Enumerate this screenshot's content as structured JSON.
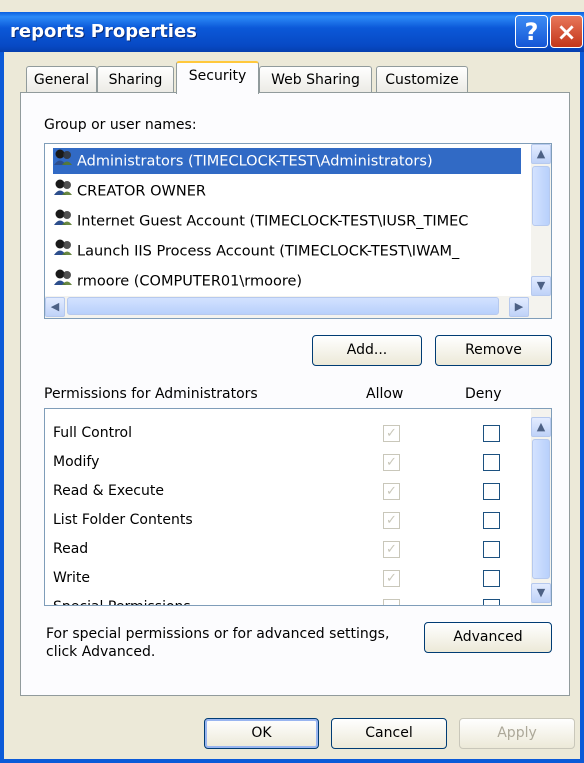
{
  "window": {
    "title": "reports Properties",
    "help_glyph": "?",
    "close_glyph": "×"
  },
  "tabs": [
    {
      "label": "General"
    },
    {
      "label": "Sharing"
    },
    {
      "label": "Security"
    },
    {
      "label": "Web Sharing"
    },
    {
      "label": "Customize"
    }
  ],
  "security": {
    "group_label": "Group or user names:",
    "users": [
      {
        "name": "Administrators (TIMECLOCK-TEST\\Administrators)",
        "selected": true
      },
      {
        "name": "CREATOR OWNER"
      },
      {
        "name": "Internet Guest Account (TIMECLOCK-TEST\\IUSR_TIMEC"
      },
      {
        "name": "Launch IIS Process Account (TIMECLOCK-TEST\\IWAM_"
      },
      {
        "name": "rmoore (COMPUTER01\\rmoore)"
      }
    ],
    "add_label": "Add...",
    "remove_label": "Remove",
    "permissions_label": "Permissions for Administrators",
    "allow_label": "Allow",
    "deny_label": "Deny",
    "permissions": [
      {
        "name": "Full Control",
        "allow": true,
        "deny": false
      },
      {
        "name": "Modify",
        "allow": true,
        "deny": false
      },
      {
        "name": "Read & Execute",
        "allow": true,
        "deny": false
      },
      {
        "name": "List Folder Contents",
        "allow": true,
        "deny": false
      },
      {
        "name": "Read",
        "allow": true,
        "deny": false
      },
      {
        "name": "Write",
        "allow": true,
        "deny": false
      },
      {
        "name": "Special Permissions",
        "allow": false,
        "deny": false
      }
    ],
    "advanced_text_line1": "For special permissions or for advanced settings,",
    "advanced_text_line2": "click Advanced.",
    "advanced_label": "Advanced"
  },
  "footer": {
    "ok_label": "OK",
    "cancel_label": "Cancel",
    "apply_label": "Apply"
  },
  "colors": {
    "titlebar": "#0b58d8",
    "selection": "#316ac5",
    "dialog_bg": "#ece9d8"
  }
}
